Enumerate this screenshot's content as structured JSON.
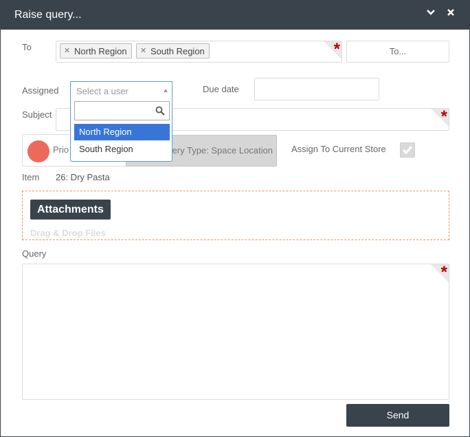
{
  "dialog": {
    "title": "Raise query..."
  },
  "titlebar": {
    "collapse_icon": "chevron-down-icon",
    "close_icon": "close-icon"
  },
  "to": {
    "label": "To",
    "tags": [
      "North Region",
      "South Region"
    ],
    "button_label": "To..."
  },
  "assigned": {
    "label": "Assigned",
    "placeholder": "Select a user",
    "search_value": "",
    "options": [
      "North Region",
      "South Region"
    ],
    "highlighted": "North Region"
  },
  "due_date": {
    "label": "Due date",
    "value": ""
  },
  "subject": {
    "label": "Subject",
    "value": ""
  },
  "priority": {
    "label": "Priority",
    "visible_text": "Prio",
    "color": "#ec6a5c"
  },
  "query_type": {
    "text": "Query Type: Space Location",
    "visible_text": "ery Type: Space Location"
  },
  "assign_store": {
    "label": "Assign To Current Store",
    "checked": true
  },
  "item": {
    "label": "Item",
    "value": "26: Dry Pasta"
  },
  "attachments": {
    "button_label": "Attachments",
    "drop_text": "Drag & Drop Files"
  },
  "query": {
    "label": "Query",
    "value": ""
  },
  "send": {
    "label": "Send"
  },
  "colors": {
    "header": "#3a434c",
    "required": "#b80000",
    "highlight": "#3875d7",
    "dashed_border": "#e8926a"
  }
}
